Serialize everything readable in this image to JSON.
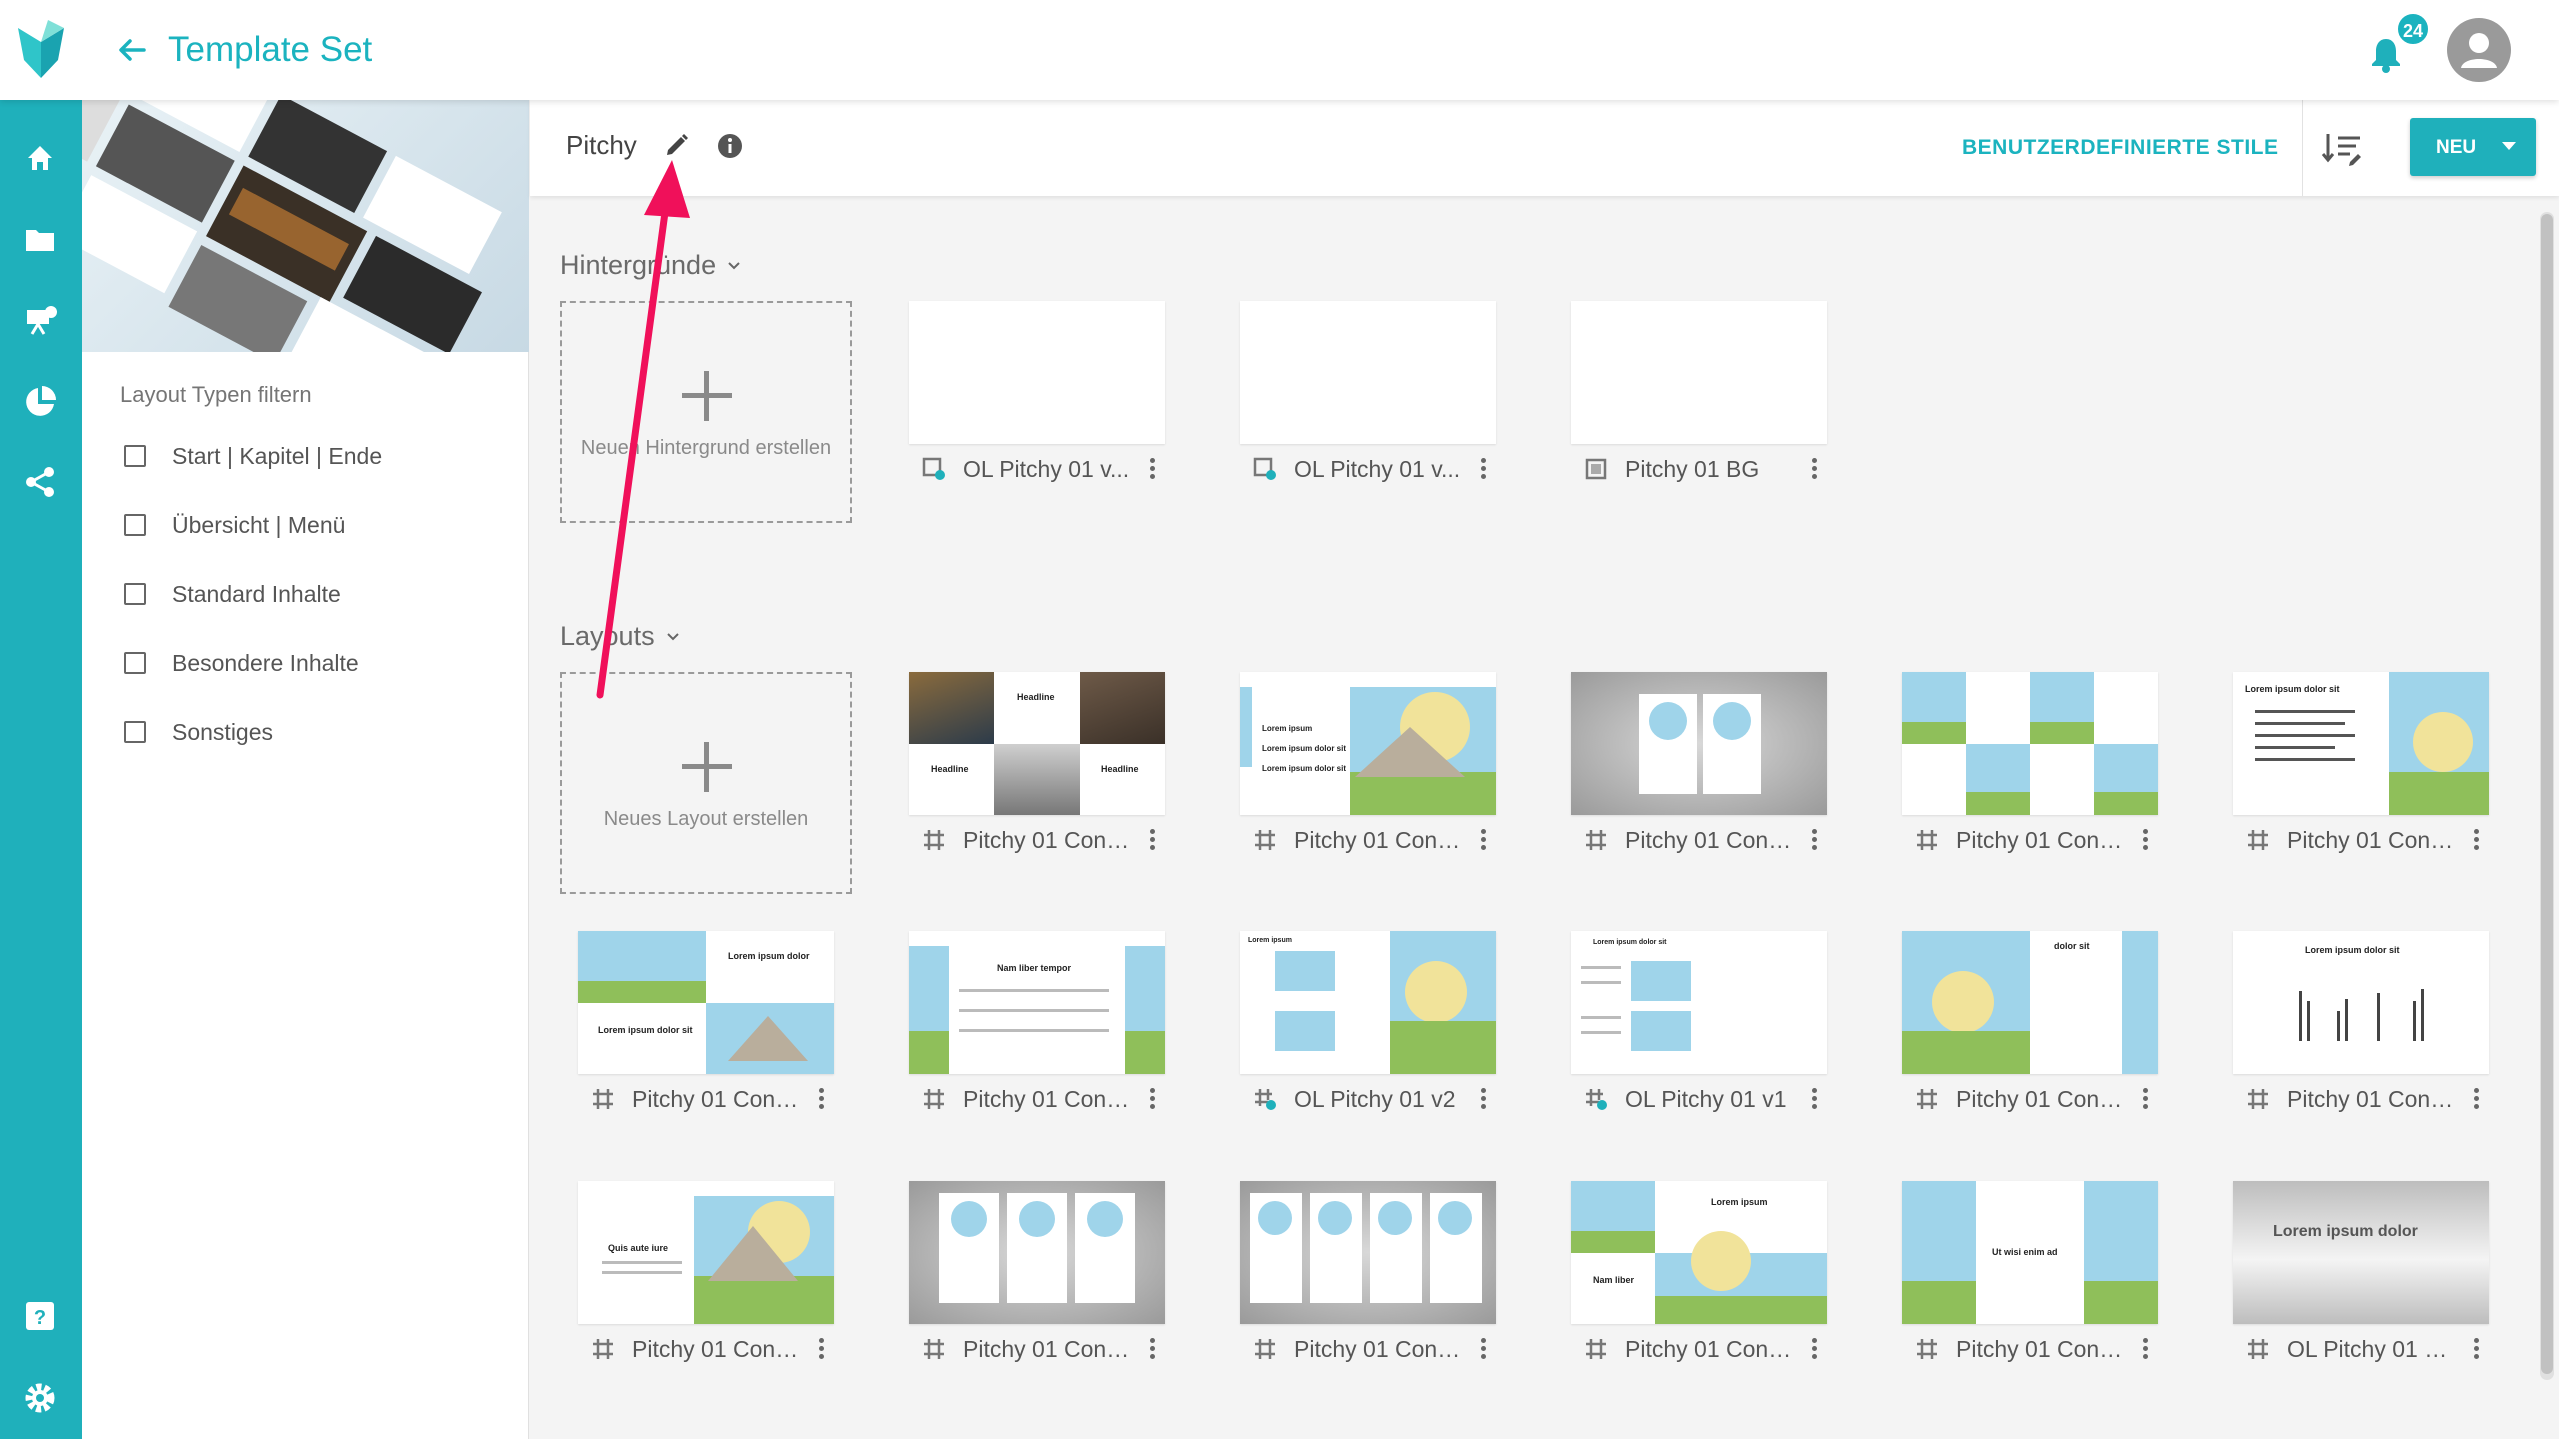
{
  "header": {
    "title": "Template Set",
    "notification_count": "24"
  },
  "toolbar": {
    "template_name": "Pitchy",
    "custom_styles_label": "BENUTZERDEFINIERTE STILE",
    "new_label": "NEU"
  },
  "filters": {
    "title": "Layout Typen filtern",
    "items": [
      {
        "label": "Start | Kapitel | Ende",
        "checked": false
      },
      {
        "label": "Übersicht | Menü",
        "checked": false
      },
      {
        "label": "Standard Inhalte",
        "checked": false
      },
      {
        "label": "Besondere Inhalte",
        "checked": false
      },
      {
        "label": "Sonstiges",
        "checked": false
      }
    ]
  },
  "backgrounds": {
    "title": "Hintergründe",
    "create_label": "Neuen Hintergrund erstellen",
    "items": [
      {
        "name": "OL Pitchy 01 v...",
        "icon": "linked-background-icon"
      },
      {
        "name": "OL Pitchy 01 v...",
        "icon": "linked-background-icon"
      },
      {
        "name": "Pitchy 01 BG",
        "icon": "background-icon"
      }
    ]
  },
  "layouts": {
    "title": "Layouts",
    "create_label": "Neues Layout erstellen",
    "items": [
      {
        "name": "Pitchy 01 Cont...",
        "icon": "layout-icon"
      },
      {
        "name": "Pitchy 01 Cont...",
        "icon": "layout-icon"
      },
      {
        "name": "Pitchy 01 Cont...",
        "icon": "layout-icon"
      },
      {
        "name": "Pitchy 01 Cont...",
        "icon": "layout-icon"
      },
      {
        "name": "Pitchy 01 Cont...",
        "icon": "layout-icon"
      },
      {
        "name": "Pitchy 01 Cont...",
        "icon": "layout-icon"
      },
      {
        "name": "Pitchy 01 Cont...",
        "icon": "layout-icon"
      },
      {
        "name": "OL Pitchy 01 v2",
        "icon": "linked-layout-icon"
      },
      {
        "name": "OL Pitchy 01 v1",
        "icon": "linked-layout-icon"
      },
      {
        "name": "Pitchy 01 Cont...",
        "icon": "layout-icon"
      },
      {
        "name": "Pitchy 01 Cont...",
        "icon": "layout-icon"
      },
      {
        "name": "Pitchy 01 Cont...",
        "icon": "layout-icon"
      },
      {
        "name": "Pitchy 01 Cont...",
        "icon": "layout-icon"
      },
      {
        "name": "Pitchy 01 Cont...",
        "icon": "layout-icon"
      },
      {
        "name": "Pitchy 01 Cont...",
        "icon": "layout-icon"
      },
      {
        "name": "Pitchy 01 Cont...",
        "icon": "layout-icon"
      },
      {
        "name": "OL Pitchy 01 S...",
        "icon": "layout-icon"
      }
    ]
  },
  "thumb_text": {
    "headline": "Headline",
    "lorem_dolor_sit": "Lorem ipsum dolor sit",
    "lorem_dolor": "Lorem ipsum dolor",
    "nam_liber": "Nam liber tempor",
    "lorem_ipsum": "Lorem ipsum",
    "dolor_sit": "dolor sit",
    "quis_aute": "Quis aute iure",
    "ut_wisi": "Ut wisi enim ad",
    "nam_liber_short": "Nam liber"
  },
  "colors": {
    "brand": "#1fb0bb",
    "annotation_arrow": "#f0105a"
  }
}
